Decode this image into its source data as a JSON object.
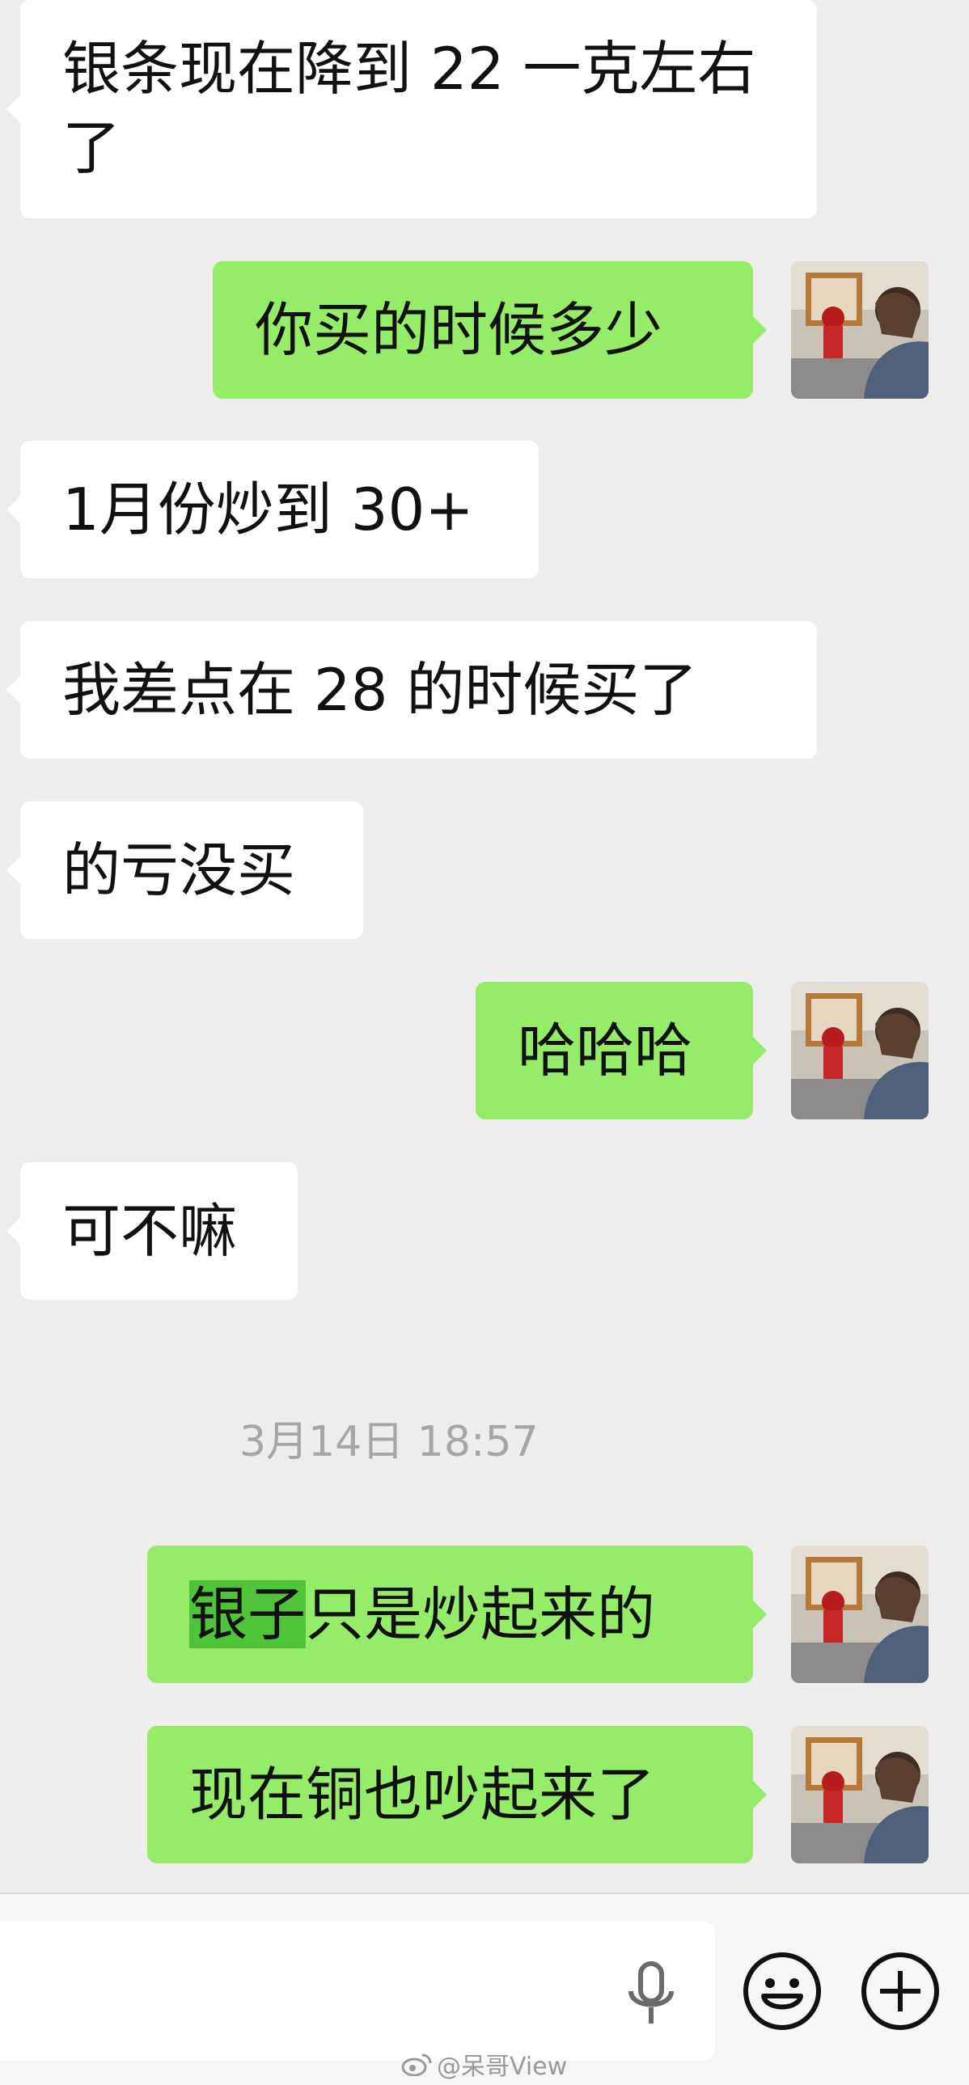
{
  "messages": [
    {
      "side": "in",
      "text": "银条现在降到 22 一克左右了"
    },
    {
      "side": "out",
      "text": "你买的时候多少"
    },
    {
      "side": "in",
      "text": "1月份炒到 30+"
    },
    {
      "side": "in",
      "text": "我差点在 28 的时候买了"
    },
    {
      "side": "in",
      "text": "的亏没买"
    },
    {
      "side": "out",
      "text": "哈哈哈"
    },
    {
      "side": "in",
      "text": "可不嘛"
    },
    {
      "side": "out",
      "highlight": "银子",
      "rest": "只是炒起来的"
    },
    {
      "side": "out",
      "text": "现在铜也吵起来了"
    }
  ],
  "timestamp": "3月14日 18:57",
  "input": {
    "placeholder": "",
    "value": ""
  },
  "icons": {
    "avatar": "avatar-photo",
    "mic": "microphone-icon",
    "emoji": "smiley-icon",
    "plus": "plus-icon",
    "weibo": "weibo-logo-icon"
  },
  "watermark": "@呆哥View",
  "colors": {
    "incoming": "#ffffff",
    "outgoing": "#95ec69",
    "highlight": "#4fc43a",
    "background": "#ededed"
  }
}
